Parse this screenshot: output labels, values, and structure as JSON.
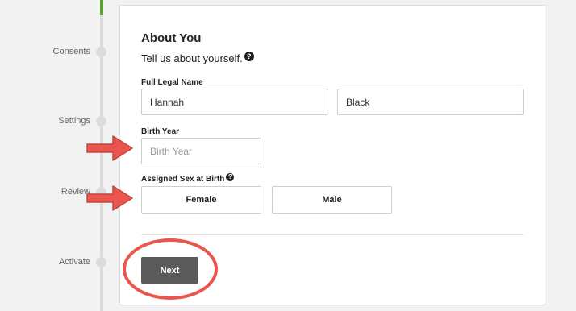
{
  "stepper": {
    "steps": [
      {
        "label": "Consents"
      },
      {
        "label": "Settings"
      },
      {
        "label": "Review"
      },
      {
        "label": "Activate"
      }
    ],
    "colors": {
      "active": "#5aa532",
      "inactive": "#dcdcdc"
    }
  },
  "form": {
    "title": "About You",
    "subtitle": "Tell us about yourself.",
    "help_icon": "question-circle-icon",
    "full_name": {
      "label": "Full Legal Name",
      "first_value": "Hannah",
      "last_value": "Black"
    },
    "birth_year": {
      "label": "Birth Year",
      "placeholder": "Birth Year",
      "value": ""
    },
    "sex": {
      "label": "Assigned Sex at Birth",
      "options": [
        "Female",
        "Male"
      ]
    },
    "next_label": "Next"
  },
  "annotations": {
    "color": "#e9564d",
    "arrows": [
      "arrow-right-icon",
      "arrow-right-icon"
    ],
    "highlight": "circle-highlight"
  }
}
